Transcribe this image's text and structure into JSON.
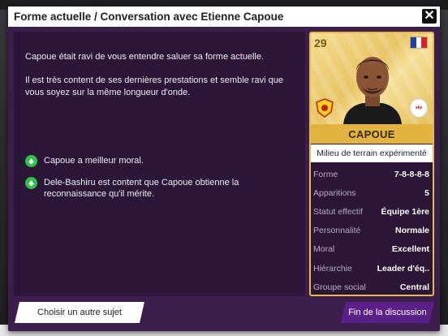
{
  "dialog": {
    "title": "Forme actuelle / Conversation avec Etienne Capoue",
    "close_icon": "close-icon"
  },
  "message": {
    "paragraph1": "Capoue était ravi de vous entendre saluer sa forme actuelle.",
    "paragraph2": "Il est très content de ses dernières prestations et semble ravi que vous soyez sur la même longueur d'onde.",
    "outcomes": [
      {
        "icon": "arrow-up-icon",
        "text": "Capoue a meilleur moral."
      },
      {
        "icon": "arrow-up-icon",
        "text": "Dele-Bashiru est content que Capoue obtienne la reconnaissance qu'il mérite."
      }
    ]
  },
  "player": {
    "age": "29",
    "nationality_flag": "france-flag-icon",
    "name": "CAPOUE",
    "role": "Milieu de terrain expérimenté",
    "stats": [
      {
        "label": "Forme",
        "value": "7-8-8-8-8"
      },
      {
        "label": "Apparitions",
        "value": "5"
      },
      {
        "label": "Statut effectif",
        "value": "Équipe 1ère"
      },
      {
        "label": "Personnalité",
        "value": "Normale"
      },
      {
        "label": "Moral",
        "value": "Excellent"
      },
      {
        "label": "Hiérarchie",
        "value": "Leader d'éq.."
      },
      {
        "label": "Groupe social",
        "value": "Central"
      }
    ]
  },
  "colors": {
    "dialog_bg": "#3b1e4c",
    "panel_bg": "#2c1638",
    "accent_gold": "#e3b340",
    "positive_green": "#2fc24a",
    "primary_button": "#5b1f8a"
  },
  "actions": {
    "left_button": "Choisir un autre sujet",
    "right_button": "Fin de la discussion"
  }
}
